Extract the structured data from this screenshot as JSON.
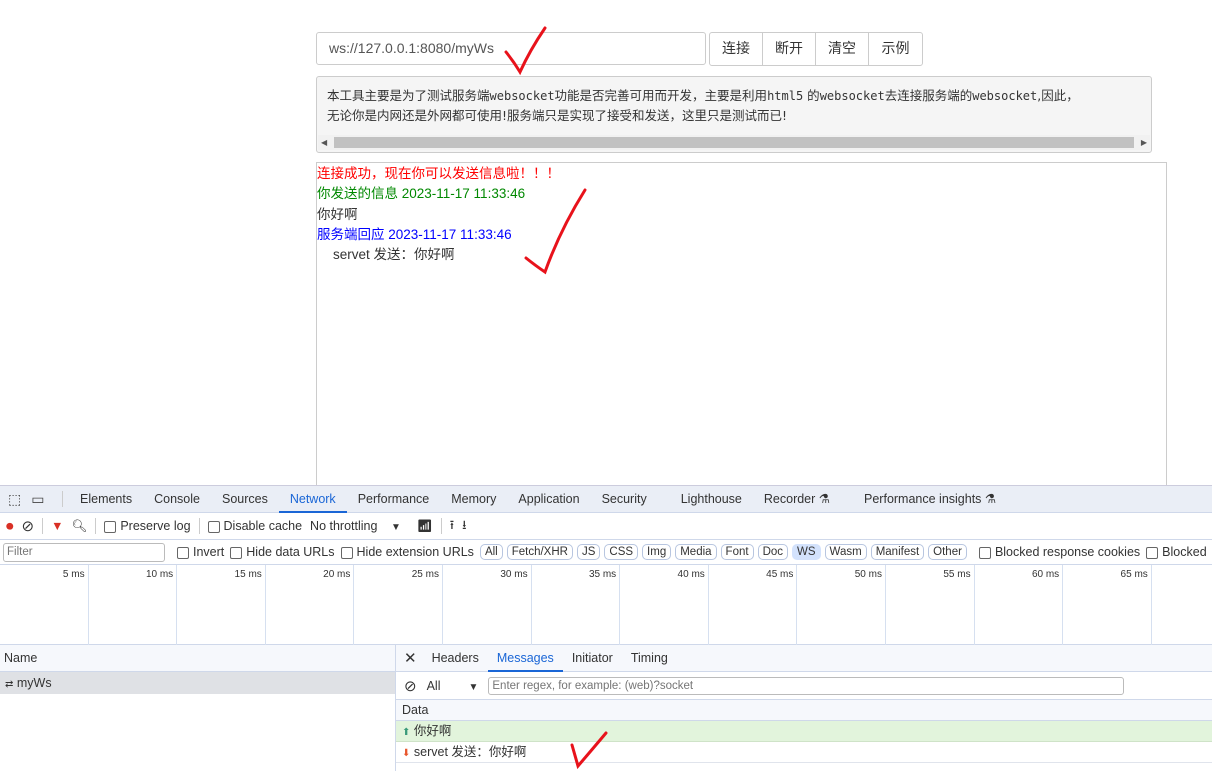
{
  "page": {
    "url_value": "ws://127.0.0.1:8080/myWs",
    "buttons": [
      "连接",
      "断开",
      "清空",
      "示例"
    ],
    "info_parts": [
      "本工具主要是为了测试服务端",
      "websocket",
      "功能是否完善可用而开发，主要是利用",
      "html5",
      "的",
      "websocket",
      "去连接服务端的",
      "websocket",
      ",因此，"
    ],
    "info_line2": "无论你是内网还是外网都可使用!服务端只是实现了接受和发送，这里只是测试而已!",
    "log": {
      "connected": "连接成功，现在你可以发送信息啦！！！",
      "sent_header": "你发送的信息 2023-11-17 11:33:46",
      "sent_body": "你好啊",
      "reply_header": "服务端回应 2023-11-17 11:33:46",
      "reply_body": "servet 发送：你好啊"
    },
    "colors": {
      "connected": "#ff0000",
      "sent": "#008800",
      "reply": "#0000ff",
      "annotation": "#e8121b"
    }
  },
  "devtools": {
    "tabs": [
      "Elements",
      "Console",
      "Sources",
      "Network",
      "Performance",
      "Memory",
      "Application",
      "Security",
      "Lighthouse",
      "Recorder",
      "Performance insights"
    ],
    "active_tab": "Network",
    "toolbar": {
      "preserve_log": "Preserve log",
      "disable_cache": "Disable cache",
      "throttling": "No throttling"
    },
    "filter": {
      "placeholder": "Filter",
      "invert": "Invert",
      "hide_data": "Hide data URLs",
      "hide_ext": "Hide extension URLs",
      "types": [
        "All",
        "Fetch/XHR",
        "JS",
        "CSS",
        "Img",
        "Media",
        "Font",
        "Doc",
        "WS",
        "Wasm",
        "Manifest",
        "Other"
      ],
      "selected_type": "WS",
      "blocked_cookies": "Blocked response cookies",
      "blocked": "Blocked"
    },
    "timeline_ticks": [
      "5 ms",
      "10 ms",
      "15 ms",
      "20 ms",
      "25 ms",
      "30 ms",
      "35 ms",
      "40 ms",
      "45 ms",
      "50 ms",
      "55 ms",
      "60 ms",
      "65 ms"
    ],
    "requests": {
      "header": "Name",
      "items": [
        "myWs"
      ]
    },
    "detail": {
      "tabs": [
        "Headers",
        "Messages",
        "Initiator",
        "Timing"
      ],
      "active": "Messages",
      "filter_option": "All",
      "regex_placeholder": "Enter regex, for example: (web)?socket",
      "data_header": "Data",
      "messages": [
        {
          "dir": "sent",
          "text": "你好啊"
        },
        {
          "dir": "received",
          "text": "servet 发送：你好啊"
        }
      ]
    }
  }
}
